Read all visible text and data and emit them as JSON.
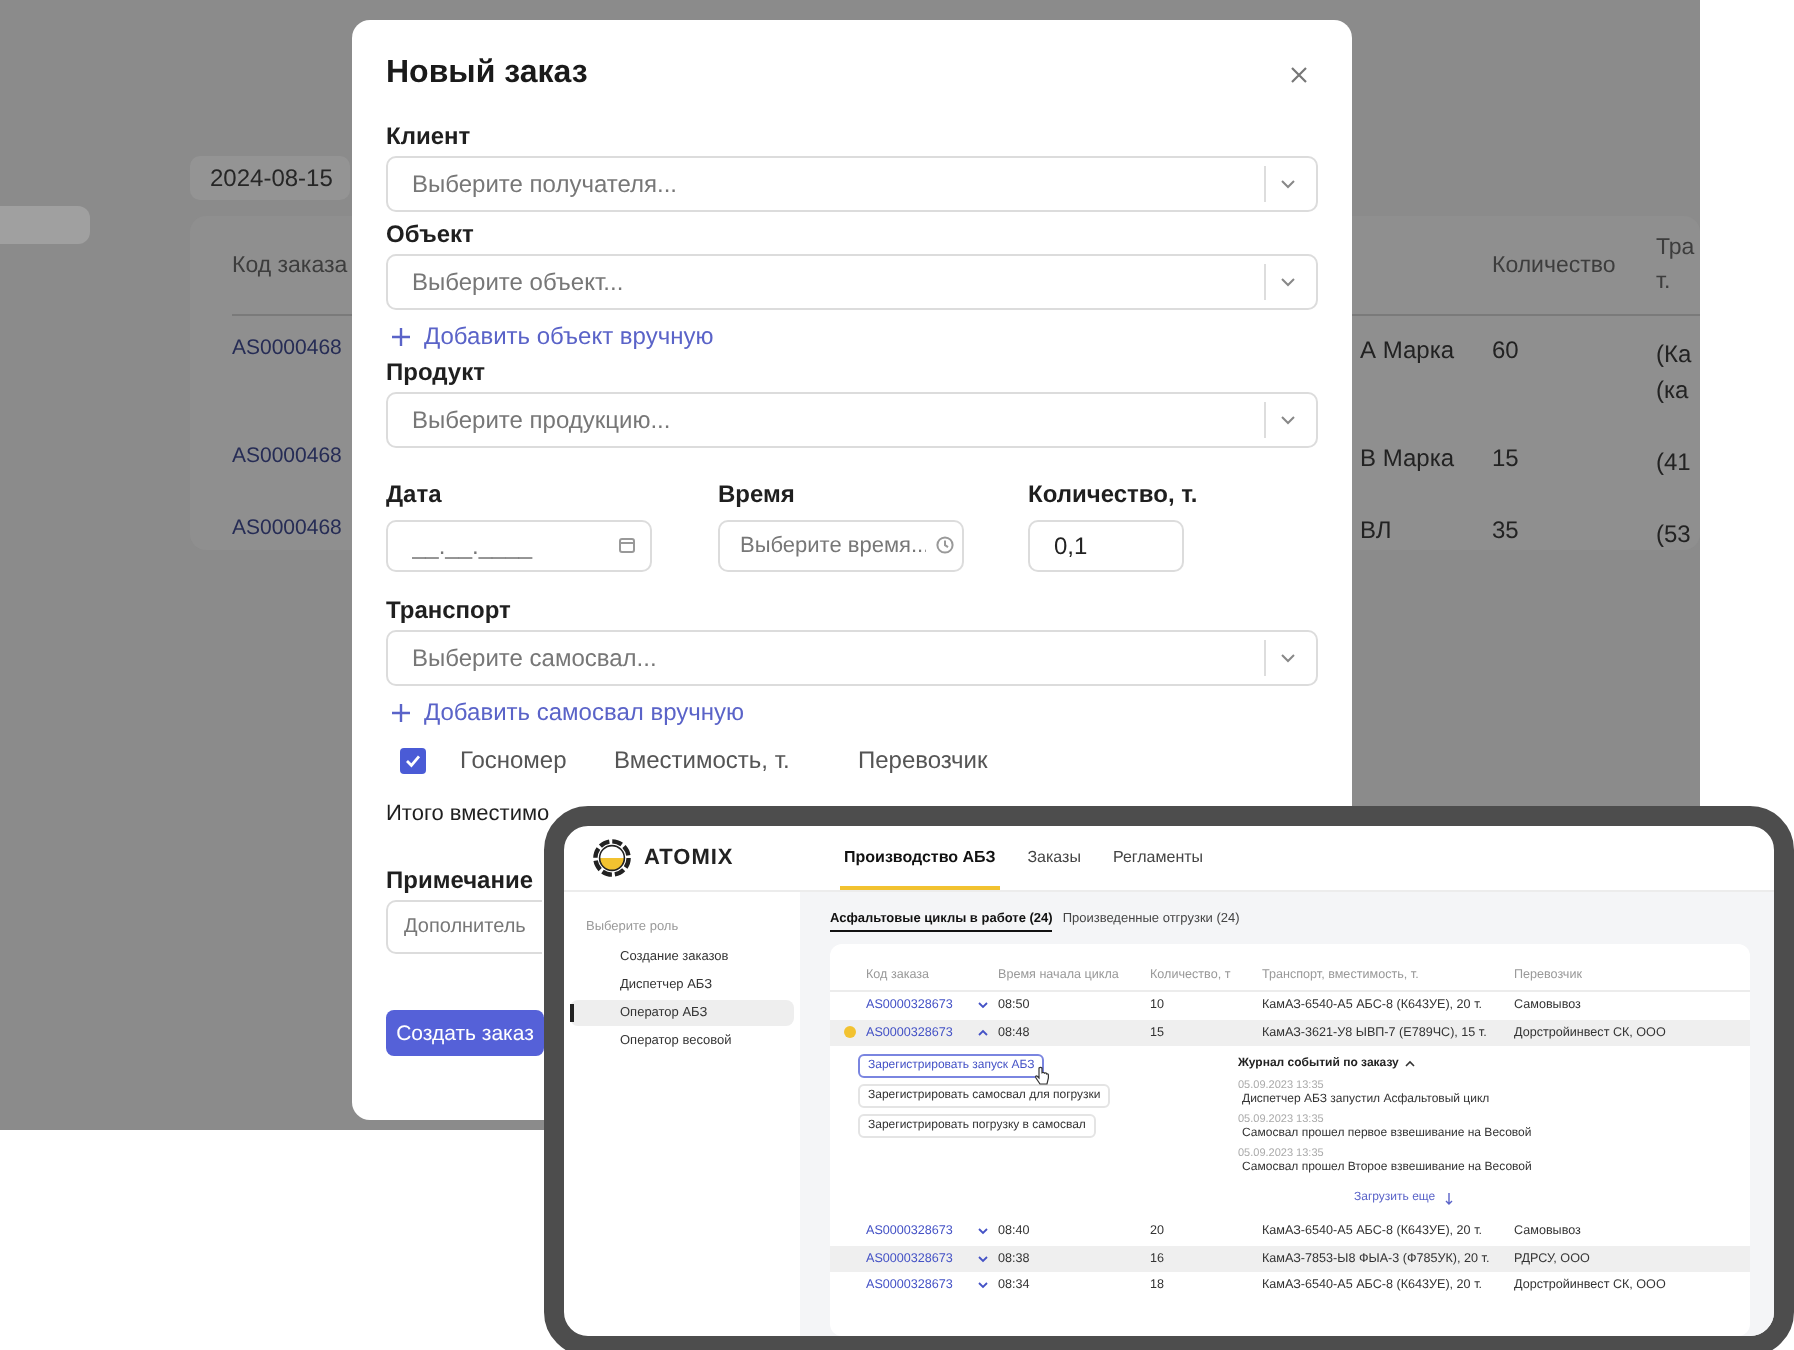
{
  "background": {
    "date": "2024-08-15",
    "table": {
      "headers": {
        "code": "Код заказа",
        "quantity": "Количество",
        "column_4": "Тра т."
      },
      "rows": [
        {
          "code": "AS0000468",
          "column_2": "А Марка",
          "quantity": "60",
          "column_4": "(Ка (ка"
        },
        {
          "code": "AS0000468",
          "column_2": "В Марка",
          "quantity": "15",
          "column_4": "(41"
        },
        {
          "code": "AS0000468",
          "column_2": "ВЛ",
          "quantity": "35",
          "column_4": "(53"
        }
      ]
    }
  },
  "modal": {
    "title": "Новый заказ",
    "client": {
      "label": "Клиент",
      "placeholder": "Выберите получателя..."
    },
    "object": {
      "label": "Объект",
      "placeholder": "Выберите объект..."
    },
    "add_object_link": "Добавить объект вручную",
    "product": {
      "label": "Продукт",
      "placeholder": "Выберите продукцию..."
    },
    "date": {
      "label": "Дата",
      "placeholder": "__.__.____"
    },
    "time": {
      "label": "Время",
      "placeholder": "Выберите время..."
    },
    "quantity": {
      "label": "Количество, т.",
      "value": "0,1"
    },
    "transport": {
      "label": "Транспорт",
      "placeholder": "Выберите самосвал..."
    },
    "add_truck_link": "Добавить самосвал вручную",
    "truck_table": {
      "checked": true,
      "columns": [
        "Госномер",
        "Вместимость, т.",
        "Перевозчик"
      ]
    },
    "total_label": "Итого вместимо",
    "note": {
      "label": "Примечание",
      "placeholder": "Дополнитель"
    },
    "submit": "Создать заказ"
  },
  "inset": {
    "logo": "ATOMIX",
    "tabs": [
      {
        "label": "Производство АБЗ",
        "selected": true
      },
      {
        "label": "Заказы",
        "selected": false
      },
      {
        "label": "Регламенты",
        "selected": false
      }
    ],
    "sidebar": {
      "heading": "Выберите роль",
      "items": [
        {
          "label": "Создание заказов",
          "selected": false
        },
        {
          "label": "Диспетчер АБЗ",
          "selected": false
        },
        {
          "label": "Оператор АБЗ",
          "selected": true
        },
        {
          "label": "Оператор весовой",
          "selected": false
        }
      ]
    },
    "subtabs": [
      {
        "label": "Асфальтовые циклы в работе (24)",
        "selected": true
      },
      {
        "label": "Произведенные отгрузки (24)",
        "selected": false
      }
    ],
    "table": {
      "columns": [
        "Код заказа",
        "Время начала цикла",
        "Количество, т",
        "Транспорт, вместимость, т.",
        "Перевозчик"
      ],
      "rows": [
        {
          "code": "AS0000328673",
          "status_dot": false,
          "expanded": false,
          "time": "08:50",
          "quantity": "10",
          "transport": "КамАЗ-6540-А5 АБС-8 (К643УЕ), 20 т.",
          "carrier": "Самовывоз"
        },
        {
          "code": "AS0000328673",
          "status_dot": true,
          "expanded": true,
          "time": "08:48",
          "quantity": "15",
          "transport": "КамАЗ-3621-У8 ЫВП-7 (Е789ЧС), 15 т.",
          "carrier": "Дорстройинвест СК, ООО"
        },
        {
          "code": "AS0000328673",
          "status_dot": false,
          "expanded": false,
          "time": "08:40",
          "quantity": "20",
          "transport": "КамАЗ-6540-А5 АБС-8 (К643УЕ), 20 т.",
          "carrier": "Самовывоз"
        },
        {
          "code": "AS0000328673",
          "status_dot": false,
          "expanded": false,
          "time": "08:38",
          "quantity": "16",
          "transport": "КамАЗ-7853-Ы8 ФЫА-3 (Ф785УК), 20 т.",
          "carrier": "РДРСУ, ООО"
        },
        {
          "code": "AS0000328673",
          "status_dot": false,
          "expanded": false,
          "time": "08:34",
          "quantity": "18",
          "transport": "КамАЗ-6540-А5 АБС-8 (К643УЕ), 20 т.",
          "carrier": "Дорстройинвест СК, ООО"
        }
      ]
    },
    "details": {
      "actions": [
        {
          "label": "Зарегистрировать запуск АБЗ",
          "selected": true
        },
        {
          "label": "Зарегистрировать самосвал для погрузки",
          "selected": false
        },
        {
          "label": "Зарегистрировать погрузку в самосвал",
          "selected": false
        }
      ],
      "journal": {
        "title": "Журнал событий по заказу",
        "events": [
          {
            "date": "05.09.2023 13:35",
            "text": "Диспетчер АБЗ запустил Асфальтовый цикл"
          },
          {
            "date": "05.09.2023 13:35",
            "text": "Самосвал прошел первое взвешивание на Весовой"
          },
          {
            "date": "05.09.2023 13:35",
            "text": "Самосвал прошел Второе взвешивание на Весовой"
          }
        ],
        "load_more": "Загрузить еще"
      }
    }
  }
}
